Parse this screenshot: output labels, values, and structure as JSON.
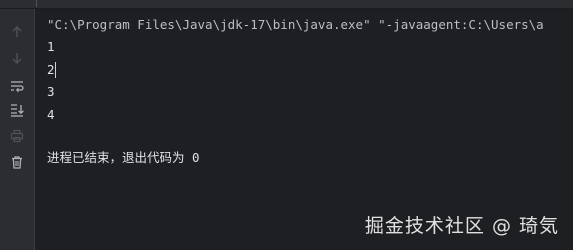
{
  "console": {
    "command_line": "\"C:\\Program Files\\Java\\jdk-17\\bin\\java.exe\" \"-javaagent:C:\\Users\\a",
    "output_lines": [
      "1",
      "2",
      "3",
      "4"
    ],
    "exit_message": "进程已结束，退出代码为 0"
  },
  "watermark": {
    "text": "掘金技术社区 @ 琦気"
  },
  "sidebar": {
    "icons": [
      "arrow-up-icon",
      "arrow-down-icon",
      "soft-wrap-icon",
      "scroll-to-end-icon",
      "print-icon",
      "trash-icon"
    ]
  },
  "colors": {
    "background": "#1e1f22",
    "sidebar": "#2b2d30",
    "text": "#dfe1e5",
    "icon_disabled": "#4e5157",
    "icon_enabled": "#aeb2b8"
  }
}
